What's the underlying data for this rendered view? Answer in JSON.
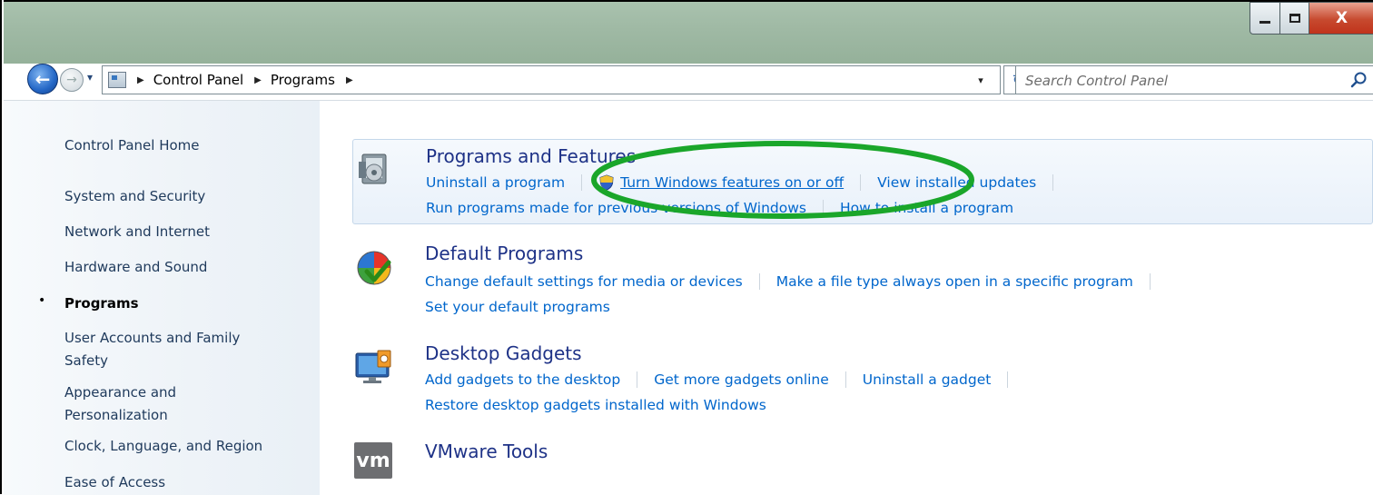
{
  "window": {
    "minimize_glyph": "minimize-icon",
    "maximize_glyph": "maximize-icon",
    "close_label": "X"
  },
  "nav": {
    "back_arrow": "←",
    "forward_arrow": "→",
    "history_arrow": "▾",
    "breadcrumb_separator": "▶",
    "breadcrumbs": [
      "Control Panel",
      "Programs"
    ],
    "address_dropdown": "▾",
    "refresh_glyph": "↻",
    "search_placeholder": "Search Control Panel"
  },
  "sidebar": {
    "items": [
      {
        "label": "Control Panel Home"
      },
      {
        "label": "System and Security"
      },
      {
        "label": "Network and Internet"
      },
      {
        "label": "Hardware and Sound"
      },
      {
        "label": "Programs",
        "current": true
      },
      {
        "label": "User Accounts and Family"
      },
      {
        "label": "Safety"
      },
      {
        "label": "Appearance and"
      },
      {
        "label": "Personalization"
      },
      {
        "label": "Clock, Language, and Region"
      },
      {
        "label": "Ease of Access"
      }
    ],
    "bullet": "•"
  },
  "categories": [
    {
      "title": "Programs and Features",
      "icon": "programs-and-features-icon",
      "lines": [
        [
          "Uninstall a program",
          "Turn Windows features on or off",
          "View installed updates"
        ],
        [
          "Run programs made for previous versions of Windows",
          "How to install a program"
        ]
      ]
    },
    {
      "title": "Default Programs",
      "icon": "default-programs-icon",
      "lines": [
        [
          "Change default settings for media or devices",
          "Make a file type always open in a specific program"
        ],
        [
          "Set your default programs"
        ]
      ]
    },
    {
      "title": "Desktop Gadgets",
      "icon": "desktop-gadgets-icon",
      "lines": [
        [
          "Add gadgets to the desktop",
          "Get more gadgets online",
          "Uninstall a gadget"
        ],
        [
          "Restore desktop gadgets installed with Windows"
        ]
      ]
    },
    {
      "title": "VMware Tools",
      "icon": "vmware-icon",
      "icon_text": "vm",
      "lines": []
    }
  ],
  "colors": {
    "link": "#0066cc",
    "category_title": "#1e3287",
    "highlight_ring": "#1aa62a"
  }
}
